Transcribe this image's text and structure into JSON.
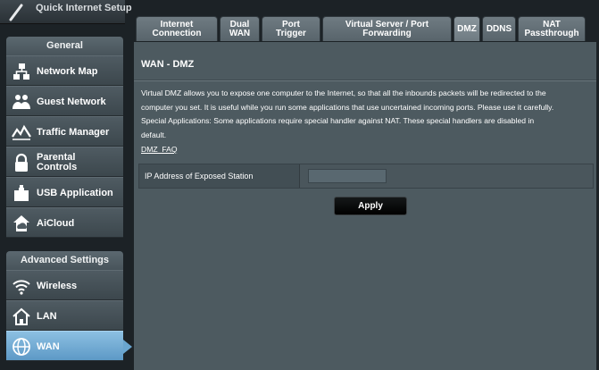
{
  "sidebar": {
    "quick_setup_label": "Quick Internet Setup",
    "general_header": "General",
    "general_items": [
      {
        "label": "Network Map",
        "icon": "network-map-icon"
      },
      {
        "label": "Guest Network",
        "icon": "guest-network-icon"
      },
      {
        "label": "Traffic Manager",
        "icon": "traffic-manager-icon"
      },
      {
        "label": "Parental\nControls",
        "icon": "parental-controls-icon"
      },
      {
        "label": "USB Application",
        "icon": "usb-application-icon"
      },
      {
        "label": "AiCloud",
        "icon": "aicloud-icon"
      }
    ],
    "advanced_header": "Advanced Settings",
    "advanced_items": [
      {
        "label": "Wireless",
        "icon": "wireless-icon"
      },
      {
        "label": "LAN",
        "icon": "lan-icon"
      },
      {
        "label": "WAN",
        "icon": "wan-icon",
        "active": true
      }
    ]
  },
  "tabs": [
    {
      "label": "Internet\nConnection"
    },
    {
      "label": "Dual\nWAN"
    },
    {
      "label": "Port\nTrigger"
    },
    {
      "label": "Virtual Server / Port\nForwarding"
    },
    {
      "label": "DMZ",
      "active": true
    },
    {
      "label": "DDNS"
    },
    {
      "label": "NAT\nPassthrough"
    }
  ],
  "page": {
    "title": "WAN - DMZ",
    "description_line1": "Virtual DMZ allows you to expose one computer to the Internet, so that all the inbounds packets will be redirected to the",
    "description_line2": "computer you set. It is useful while you run some applications that use uncertained incoming ports. Please use it carefully.",
    "description_line3": "Special Applications: Some applications require special handler against NAT. These special handlers are disabled in",
    "description_line4": "default.",
    "faq_link": "DMZ_FAQ",
    "form": {
      "ip_label": "IP Address of Exposed Station",
      "ip_value": ""
    },
    "apply_label": "Apply"
  },
  "colors": {
    "accent_active": "#6aa6d0",
    "panel_bg": "#4d5a60",
    "sidebar_bg": "#1c2226"
  }
}
